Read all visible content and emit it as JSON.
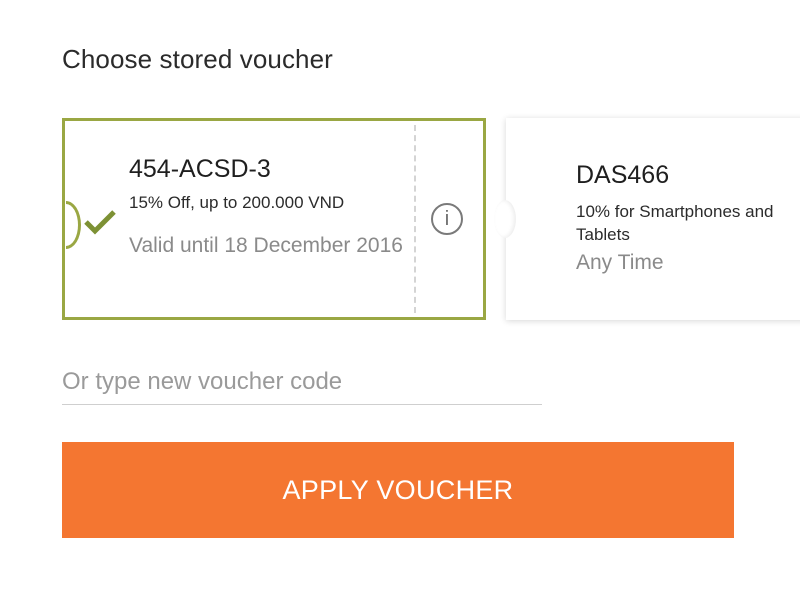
{
  "title": "Choose stored voucher",
  "vouchers": [
    {
      "code": "454-ACSD-3",
      "description": "15% Off, up to 200.000 VND",
      "validity": "Valid until 18 December 2016",
      "selected": true,
      "info_glyph": "i"
    },
    {
      "code": "DAS466",
      "description": "10% for Smartphones and Tablets",
      "validity": "Any Time",
      "selected": false
    }
  ],
  "input": {
    "placeholder": "Or type new voucher code",
    "value": ""
  },
  "apply_button": {
    "label": "APPLY VOUCHER"
  },
  "colors": {
    "selected_border": "#9aa743",
    "check": "#7d9134",
    "button_bg": "#f47631",
    "button_text": "#ffffff"
  },
  "icons": {
    "selected_indicator": "checkmark-icon",
    "info": "info-icon"
  }
}
